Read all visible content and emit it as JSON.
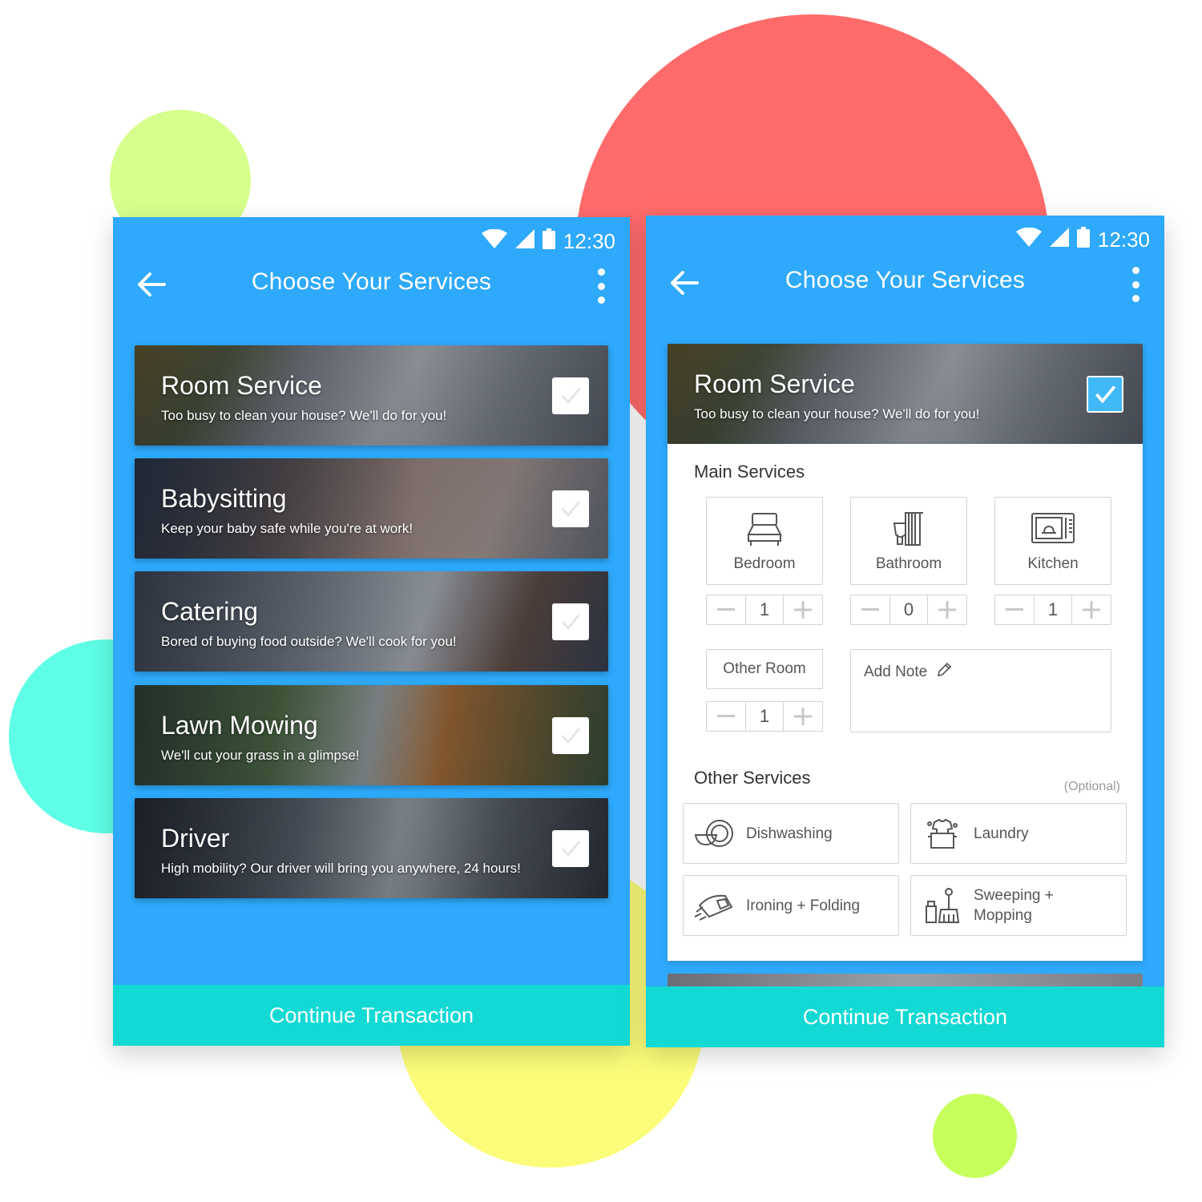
{
  "status": {
    "time": "12:30"
  },
  "appbar": {
    "title": "Choose Your Services"
  },
  "left_screen": {
    "services": [
      {
        "title": "Room Service",
        "subtitle": "Too busy to clean your house? We'll do for you!",
        "checked": false
      },
      {
        "title": "Babysitting",
        "subtitle": "Keep your baby safe while you're at work!",
        "checked": false
      },
      {
        "title": "Catering",
        "subtitle": "Bored of buying food outside? We'll cook for you!",
        "checked": false
      },
      {
        "title": "Lawn Mowing",
        "subtitle": "We'll cut your grass in a glimpse!",
        "checked": false
      },
      {
        "title": "Driver",
        "subtitle": "High mobility? Our driver will bring you anywhere, 24 hours!",
        "checked": false
      }
    ],
    "cta": "Continue Transaction"
  },
  "right_screen": {
    "selected_service": {
      "title": "Room Service",
      "subtitle": "Too busy to clean your house? We'll do for you!",
      "checked": true
    },
    "main_services_label": "Main Services",
    "rooms": [
      {
        "label": "Bedroom",
        "count": "1",
        "icon": "bed-icon"
      },
      {
        "label": "Bathroom",
        "count": "0",
        "icon": "bathroom-icon"
      },
      {
        "label": "Kitchen",
        "count": "1",
        "icon": "microwave-icon"
      }
    ],
    "other_room": {
      "label": "Other Room",
      "count": "1"
    },
    "note_placeholder": "Add Note",
    "other_services_label": "Other Services",
    "optional_label": "(Optional)",
    "other_services": [
      {
        "label": "Dishwashing",
        "icon": "dishes-icon"
      },
      {
        "label": "Laundry",
        "icon": "laundry-icon"
      },
      {
        "label": "Ironing + Folding",
        "icon": "iron-icon"
      },
      {
        "label": "Sweeping + Mopping",
        "line1": "Sweeping +",
        "line2": "Mopping",
        "icon": "broom-icon"
      }
    ],
    "cta": "Continue Transaction"
  },
  "colors": {
    "primary": "#2ea9fb",
    "cta": "#12d9d4",
    "check_on": "#41b9f7",
    "blob_red": "#ff6b6b",
    "blob_lime": "#d7ff8d",
    "blob_cyan": "#5effe6",
    "blob_yellow": "#fbfd7a",
    "blob_green": "#c6ff5c"
  }
}
